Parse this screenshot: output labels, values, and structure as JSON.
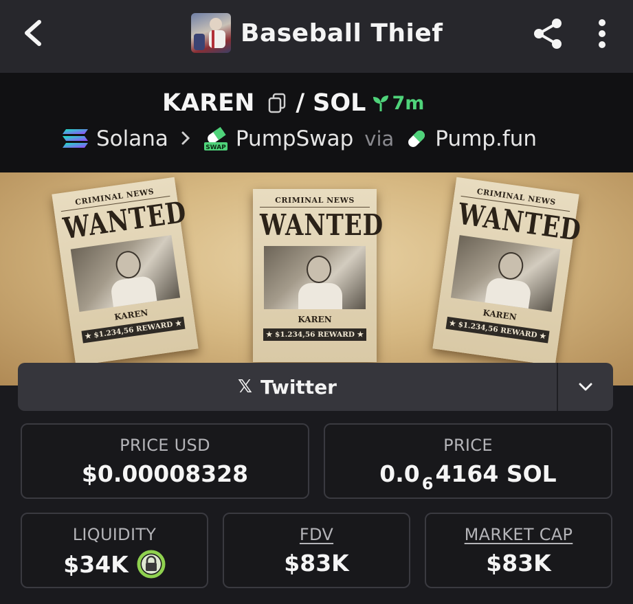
{
  "header": {
    "title": "Baseball Thief",
    "icons": {
      "back": "chevron-left-icon",
      "share": "share-icon",
      "more": "more-vertical-icon"
    }
  },
  "pair": {
    "base": "KAREN",
    "separator": "/",
    "quote": "SOL",
    "age": "7m",
    "chain": "Solana",
    "dex": "PumpSwap",
    "via_label": "via",
    "launchpad": "Pump.fun",
    "dex_badge": "SWAP"
  },
  "banner": {
    "posters": [
      {
        "top": "CRIMINAL NEWS",
        "headline": "WANTED",
        "name": "KAREN",
        "reward": "★ $1.234,56 REWARD ★"
      },
      {
        "top": "CRIMINAL NEWS",
        "headline": "WANTED",
        "name": "KAREN",
        "reward": "★ $1.234,56 REWARD ★"
      },
      {
        "top": "CRIMINAL NEWS",
        "headline": "WANTED",
        "name": "KAREN",
        "reward": "★ $1.234,56 REWARD ★"
      }
    ]
  },
  "socials": {
    "primary_label": "Twitter",
    "primary_icon": "x-logo-icon"
  },
  "stats": {
    "price_usd": {
      "label": "PRICE USD",
      "value": "$0.00008328"
    },
    "price": {
      "label": "PRICE",
      "prefix": "0.0",
      "zeros_subscript": "6",
      "digits": "4164",
      "unit": "SOL"
    },
    "liquidity": {
      "label": "LIQUIDITY",
      "value": "$34K"
    },
    "fdv": {
      "label": "FDV",
      "value": "$83K"
    },
    "market_cap": {
      "label": "MARKET CAP",
      "value": "$83K"
    }
  },
  "colors": {
    "accent_green": "#4fd37a",
    "lock_green": "#8fd14f",
    "bg": "#1a1a1e"
  }
}
